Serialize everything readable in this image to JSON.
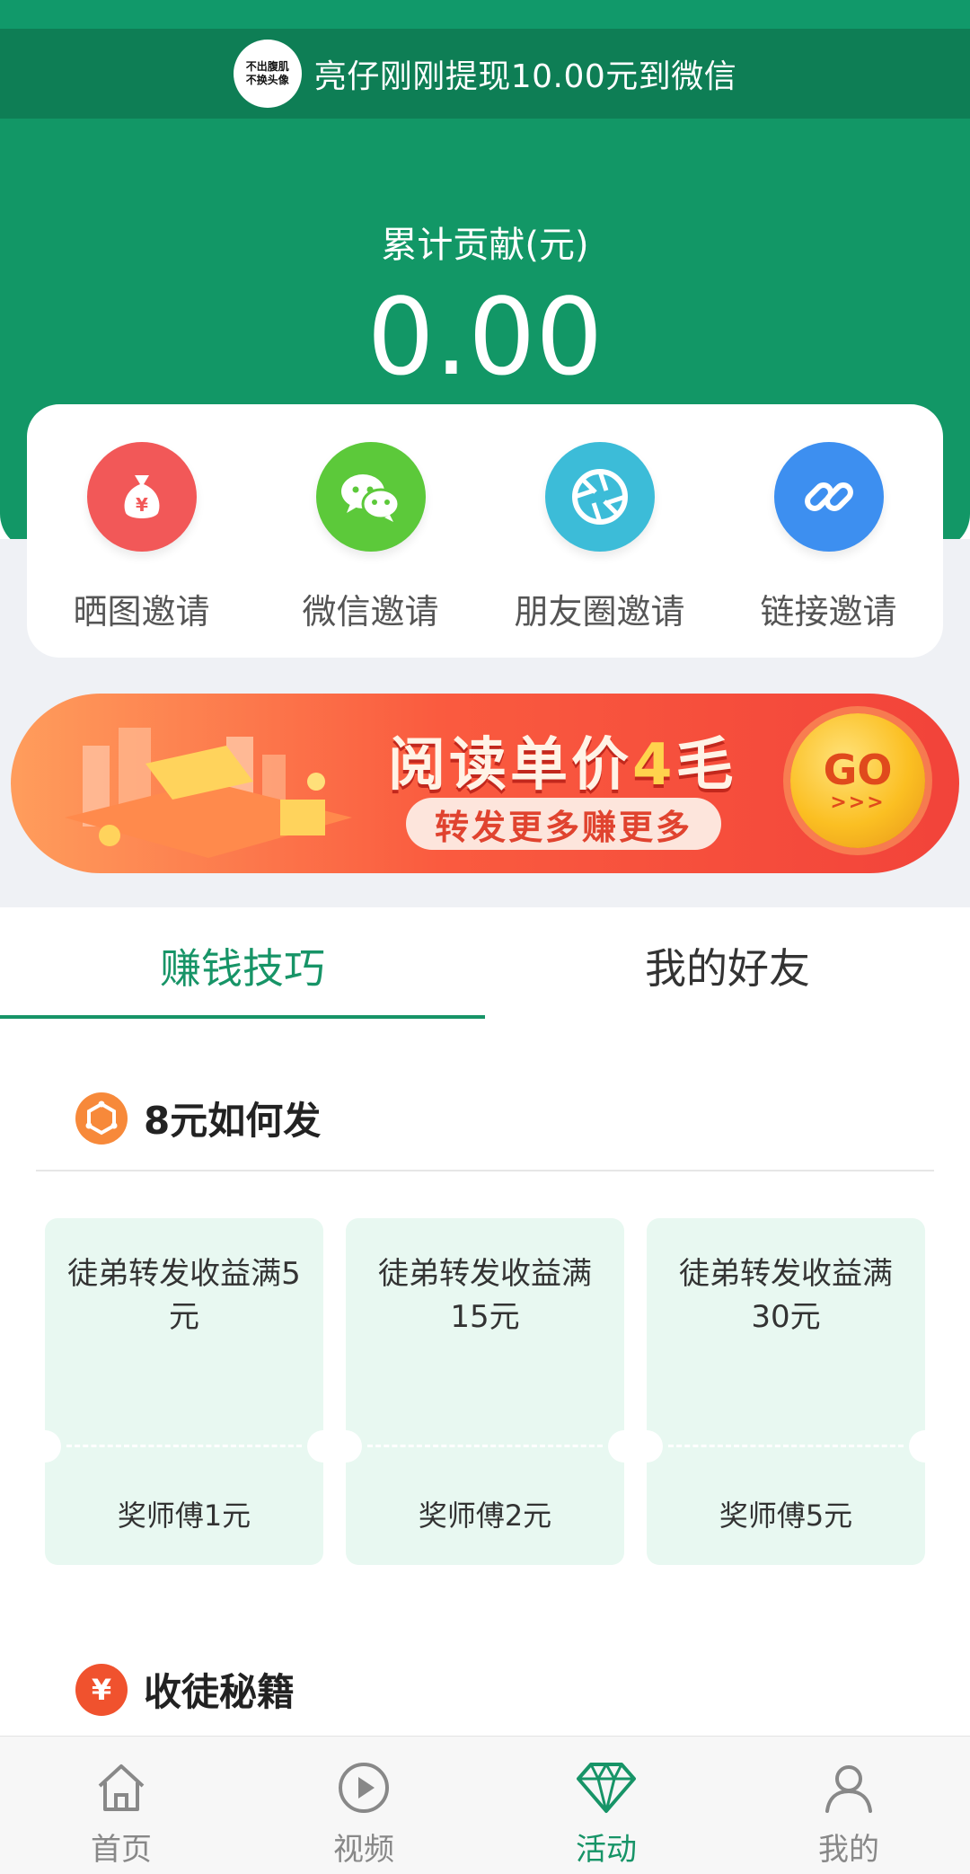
{
  "notice": {
    "avatar_line1": "不出腹肌",
    "avatar_line2": "不换头像",
    "text": "亮仔刚刚提现10.00元到微信"
  },
  "contribution": {
    "label": "累计贡献(元)",
    "value": "0.00"
  },
  "invite_methods": [
    {
      "label": "晒图邀请",
      "icon": "money-bag-icon",
      "color": "#f25858"
    },
    {
      "label": "微信邀请",
      "icon": "wechat-icon",
      "color": "#5cc93a"
    },
    {
      "label": "朋友圈邀请",
      "icon": "moments-shutter-icon",
      "color": "#3cbcd8"
    },
    {
      "label": "链接邀请",
      "icon": "link-icon",
      "color": "#3d8ff0"
    }
  ],
  "banner": {
    "title_prefix": "阅读单价",
    "title_number": "4",
    "title_suffix": "毛",
    "subtitle": "转发更多赚更多",
    "go_label": "GO",
    "go_arrows": ">>>"
  },
  "tabs": [
    {
      "label": "赚钱技巧",
      "active": true
    },
    {
      "label": "我的好友",
      "active": false
    }
  ],
  "section_rewards": {
    "title": "8元如何发",
    "cards": [
      {
        "condition": "徒弟转发收益满5元",
        "reward": "奖师傅1元"
      },
      {
        "condition": "徒弟转发收益满15元",
        "reward": "奖师傅2元"
      },
      {
        "condition": "徒弟转发收益满30元",
        "reward": "奖师傅5元"
      }
    ]
  },
  "section_tips": {
    "title": "收徒秘籍",
    "icon_symbol": "¥"
  },
  "bottom_nav": [
    {
      "label": "首页",
      "icon": "home-icon",
      "active": false
    },
    {
      "label": "视频",
      "icon": "video-play-icon",
      "active": false
    },
    {
      "label": "活动",
      "icon": "diamond-icon",
      "active": true
    },
    {
      "label": "我的",
      "icon": "user-icon",
      "active": false
    }
  ],
  "colors": {
    "brand_green": "#129766",
    "notice_bar": "#0e7e55",
    "active_tab": "#179467",
    "card_bg": "#e8f8f1"
  }
}
